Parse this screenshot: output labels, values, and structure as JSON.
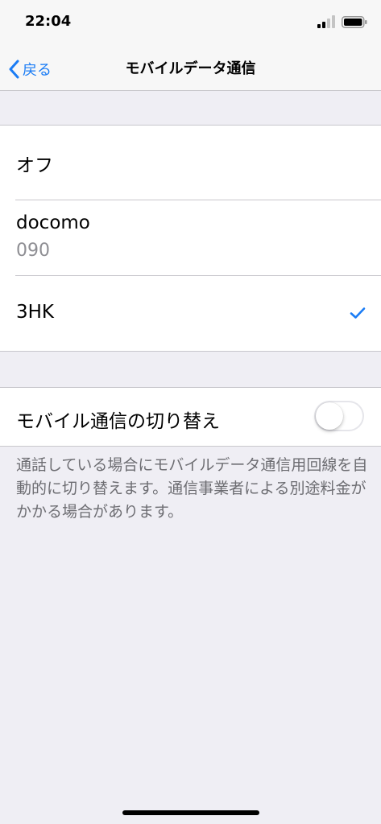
{
  "status_bar": {
    "time": "22:04"
  },
  "nav": {
    "back_label": "戻る",
    "title": "モバイルデータ通信"
  },
  "carriers": [
    {
      "title": "オフ",
      "subtitle": "",
      "selected": false
    },
    {
      "title": "docomo",
      "subtitle": "090",
      "selected": false
    },
    {
      "title": "3HK",
      "subtitle": "",
      "selected": true
    }
  ],
  "switch_row": {
    "label": "モバイル通信の切り替え",
    "enabled": false
  },
  "footer_text": "通話している場合にモバイルデータ通信用回線を自動的に切り替えます。通信事業者による別途料金がかかる場合があります。",
  "colors": {
    "accent": "#1a7cf5",
    "background": "#efeef4",
    "separator": "#c8c7cc"
  }
}
